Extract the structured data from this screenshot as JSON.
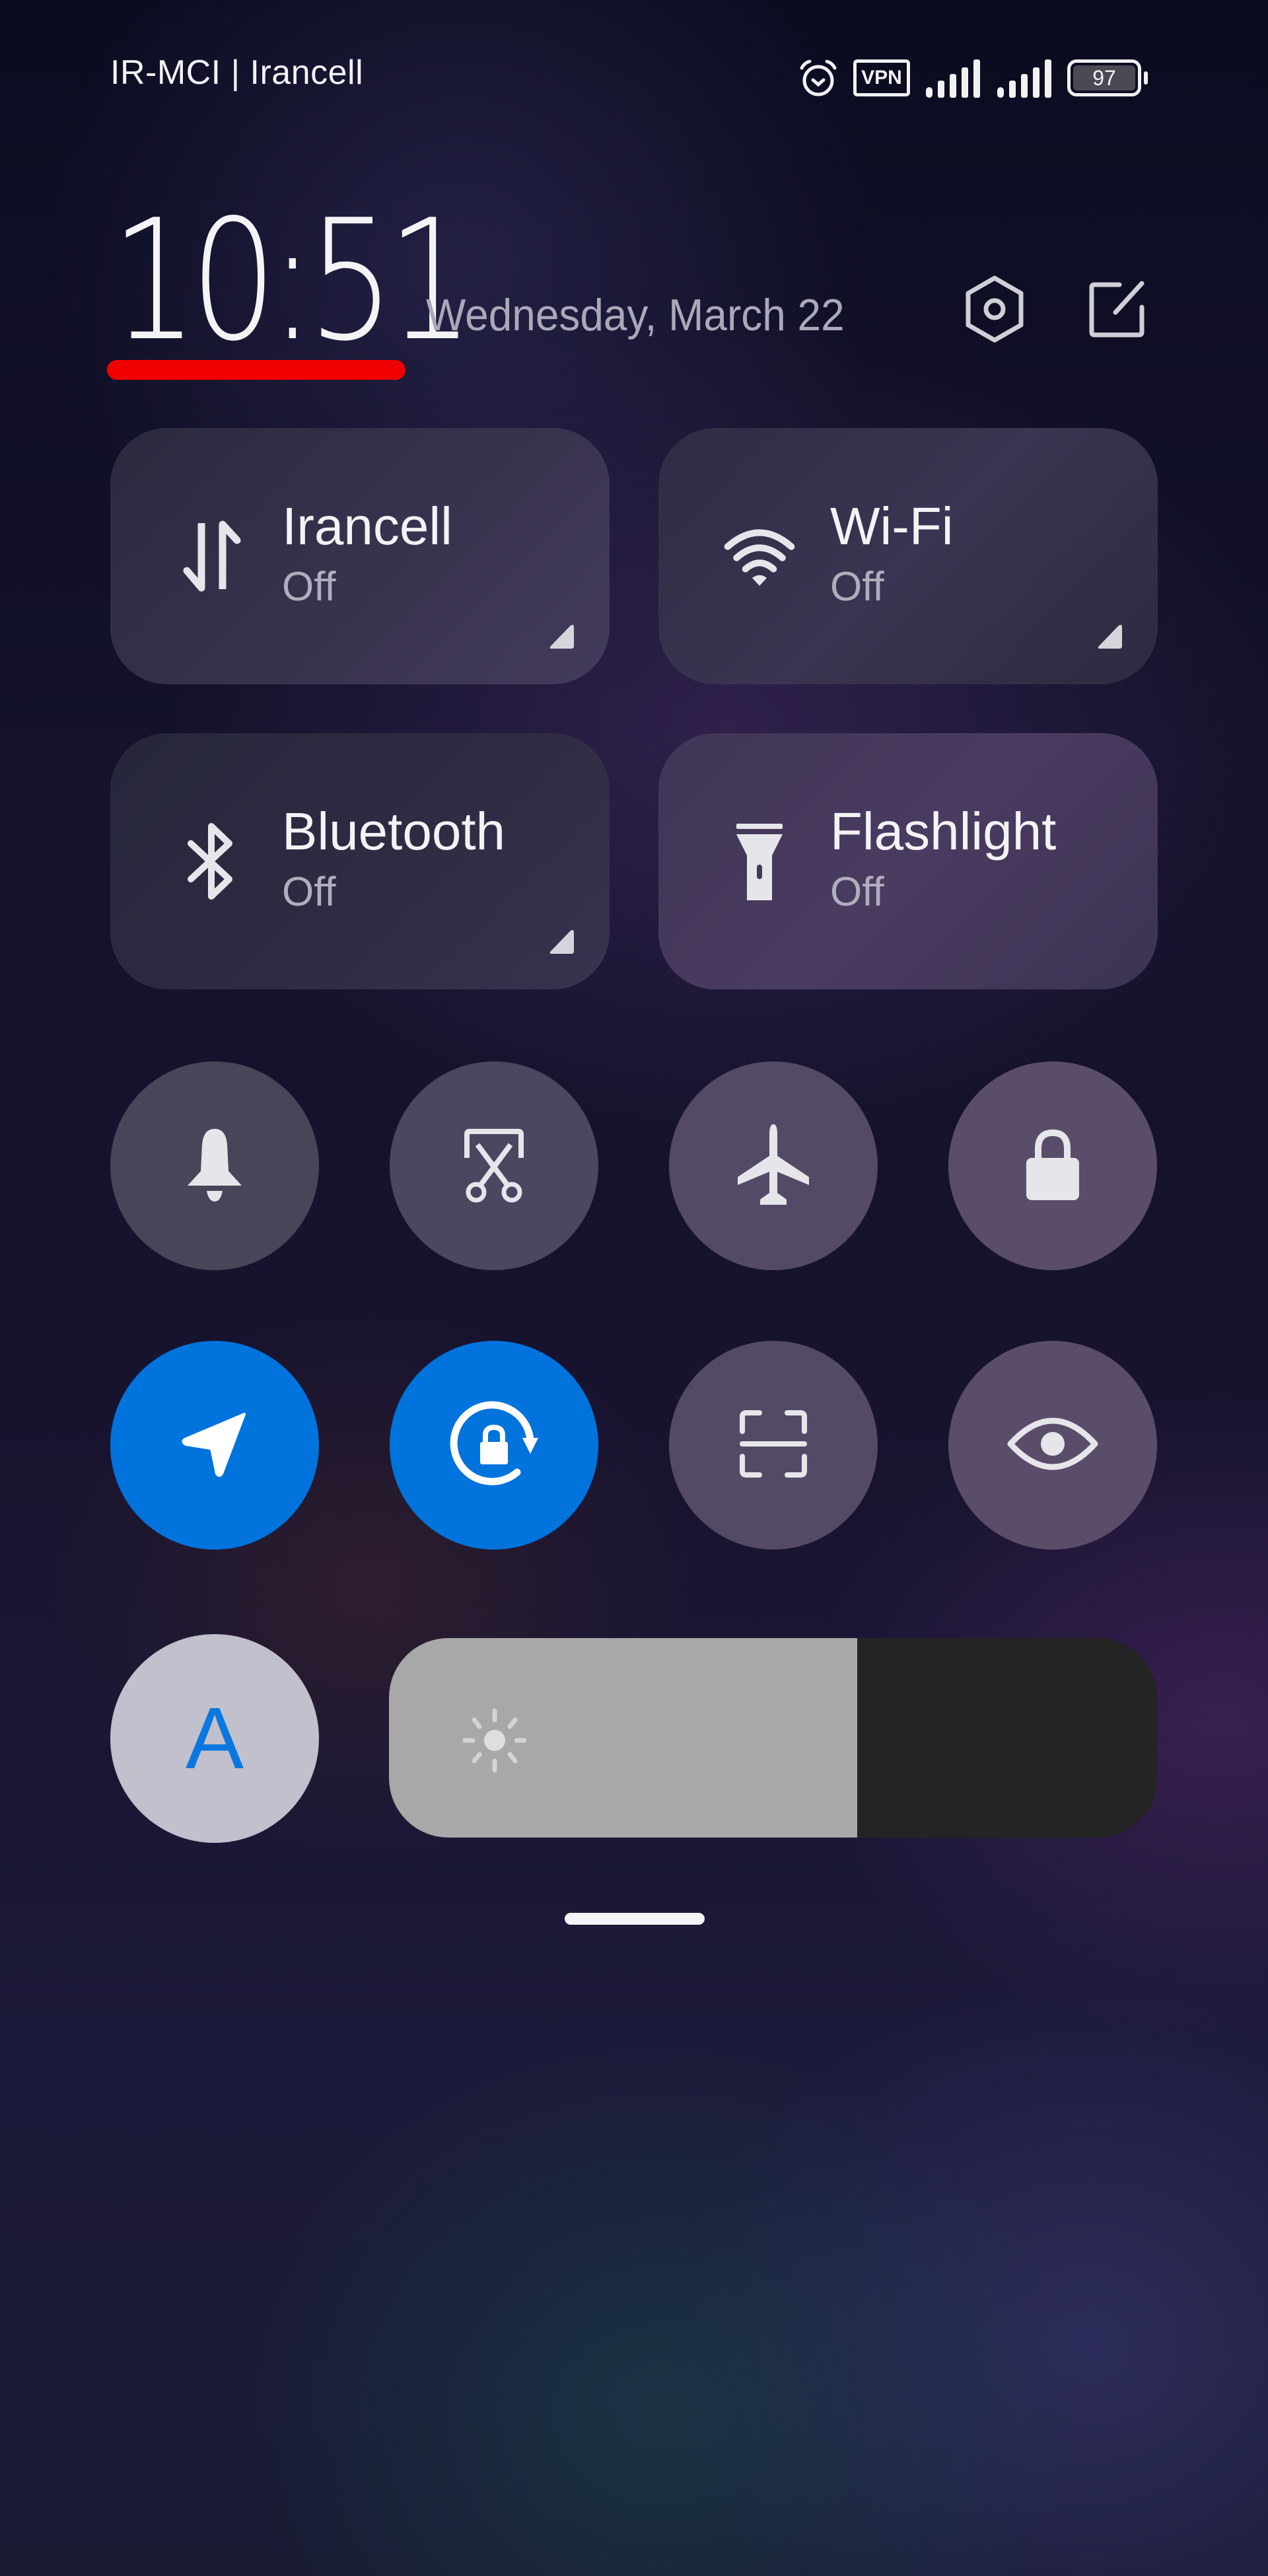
{
  "status_bar": {
    "carrier": "IR-MCI | Irancell",
    "icons": [
      "alarm-icon",
      "vpn-icon",
      "signal-sim1-icon",
      "signal-sim2-icon",
      "battery-icon"
    ],
    "vpn_label": "VPN",
    "battery_level": "97"
  },
  "header": {
    "time": "10:51",
    "date": "Wednesday, March 22",
    "highlight_color": "#f00000",
    "actions": [
      "settings-icon",
      "edit-icon"
    ]
  },
  "tiles": [
    {
      "title": "Irancell",
      "status": "Off",
      "icon": "mobile-data-icon",
      "has_expand": true
    },
    {
      "title": "Wi-Fi",
      "status": "Off",
      "icon": "wifi-icon",
      "has_expand": true
    },
    {
      "title": "Bluetooth",
      "status": "Off",
      "icon": "bluetooth-icon",
      "has_expand": true
    },
    {
      "title": "Flashlight",
      "status": "Off",
      "icon": "flashlight-icon",
      "has_expand": false
    }
  ],
  "toggles": [
    {
      "name": "ring",
      "icon": "bell-icon",
      "active": false
    },
    {
      "name": "screenshot",
      "icon": "scissors-icon",
      "active": false
    },
    {
      "name": "airplane-mode",
      "icon": "airplane-icon",
      "active": false
    },
    {
      "name": "lock-screen",
      "icon": "lock-icon",
      "active": false
    },
    {
      "name": "location",
      "icon": "location-arrow-icon",
      "active": true
    },
    {
      "name": "rotation-lock",
      "icon": "rotation-lock-icon",
      "active": true
    },
    {
      "name": "scanner",
      "icon": "scan-icon",
      "active": false
    },
    {
      "name": "reading-mode",
      "icon": "eye-icon",
      "active": false
    }
  ],
  "brightness": {
    "auto_label": "A",
    "auto_active": true,
    "level_percent": 61
  },
  "colors": {
    "active": "#0073dd",
    "brightness_fill": "#a8a8a8",
    "brightness_track": "#242424"
  }
}
